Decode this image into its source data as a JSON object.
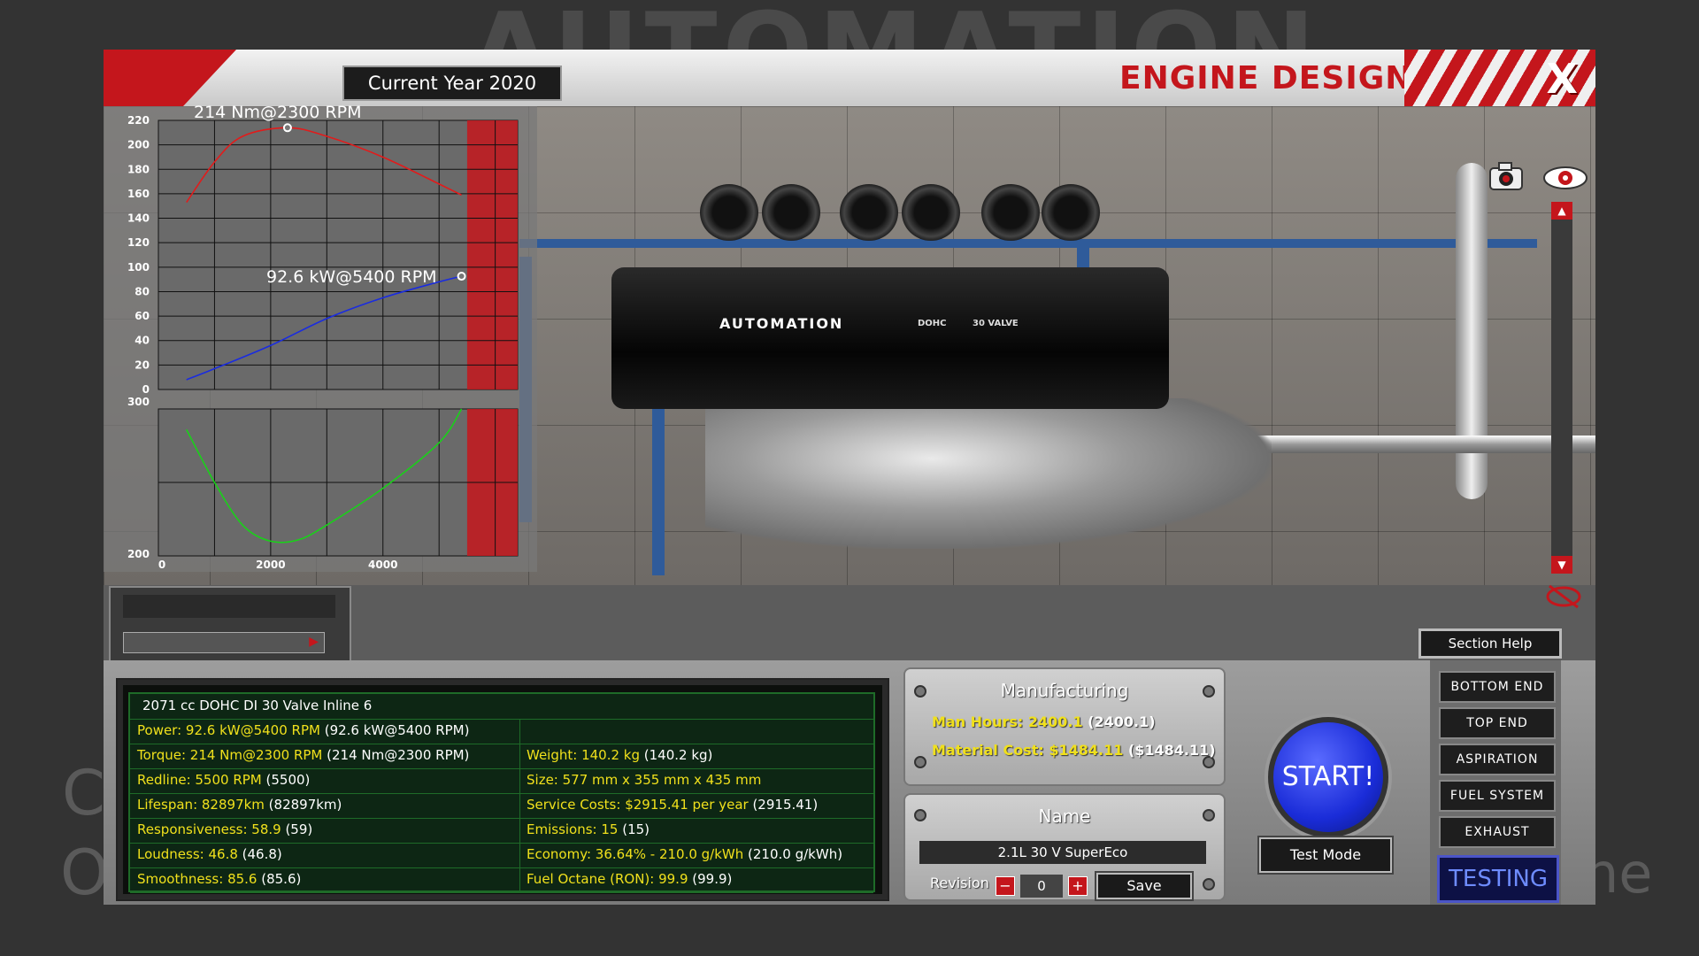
{
  "background": {
    "title_text": "AUTOMATION",
    "left_fragment_1": "C",
    "left_fragment_2": "O",
    "right_fragment": "he"
  },
  "header": {
    "current_year": "Current Year 2020",
    "section_title": "ENGINE DESIGN",
    "close_label": "X"
  },
  "engine_model": {
    "cover_logo": "AUTOMATION",
    "cover_dohc": "DOHC",
    "cover_valve": "30 VALVE"
  },
  "graph": {
    "torque_peak_label": "214 Nm@2300 RPM",
    "power_peak_label": "92.6 kW@5400 RPM",
    "top_y_ticks": [
      "220",
      "200",
      "180",
      "160",
      "140",
      "120",
      "100",
      "80",
      "60",
      "40",
      "20",
      "0"
    ],
    "bottom_y_ticks": [
      "300",
      "200"
    ],
    "x_ticks": [
      "0",
      "2000",
      "4000"
    ],
    "colors": {
      "torque": "#e21b1b",
      "power": "#1a2ce0",
      "consumption": "#19d119",
      "redline": "#c4161c"
    }
  },
  "chart_data": [
    {
      "type": "line",
      "title": "",
      "xlabel": "",
      "ylabel": "",
      "xlim": [
        0,
        6400
      ],
      "ylim": [
        0,
        220
      ],
      "series": [
        {
          "values": [
            [
              500,
              153
            ],
            [
              1000,
              186
            ],
            [
              1500,
              207
            ],
            [
              2300,
              214
            ],
            [
              3000,
              207
            ],
            [
              4000,
              190
            ],
            [
              5000,
              168
            ],
            [
              5400,
              159
            ]
          ]
        },
        {
          "values": [
            [
              500,
              8
            ],
            [
              1000,
              17
            ],
            [
              2000,
              36
            ],
            [
              3000,
              58
            ],
            [
              4000,
              75
            ],
            [
              5000,
              88
            ],
            [
              5400,
              92.6
            ]
          ]
        }
      ],
      "annotations": [
        "214 Nm@2300 RPM",
        "92.6 kW@5400 RPM"
      ]
    },
    {
      "type": "line",
      "title": "",
      "xlabel": "",
      "ylabel": "",
      "xlim": [
        0,
        6400
      ],
      "ylim": [
        200,
        300
      ],
      "series": [
        {
          "values": [
            [
              500,
              286
            ],
            [
              1000,
              250
            ],
            [
              1500,
              221
            ],
            [
              2000,
              210
            ],
            [
              2500,
              211
            ],
            [
              3000,
              221
            ],
            [
              4000,
              246
            ],
            [
              5000,
              277
            ],
            [
              5400,
              300
            ]
          ]
        }
      ]
    }
  ],
  "stats": {
    "title": "2071 cc DOHC DI 30 Valve Inline 6",
    "rows": [
      {
        "left_label": "Power: 92.6 kW@5400 RPM",
        "left_value": " (92.6 kW@5400 RPM)",
        "right_label": "",
        "right_value": ""
      },
      {
        "left_label": "Torque: 214 Nm@2300 RPM",
        "left_value": " (214 Nm@2300 RPM)",
        "right_label": "Weight: 140.2 kg",
        "right_value": " (140.2 kg)"
      },
      {
        "left_label": "Redline: 5500 RPM",
        "left_value": " (5500)",
        "right_label": "Size: 577 mm x 355 mm x 435 mm",
        "right_value": ""
      },
      {
        "left_label": "Lifespan: 82897km",
        "left_value": " (82897km)",
        "right_label": "Service Costs: $2915.41 per year",
        "right_value": " (2915.41)"
      },
      {
        "left_label": "Responsiveness: 58.9",
        "left_value": " (59)",
        "right_label": "Emissions: 15",
        "right_value": " (15)"
      },
      {
        "left_label": "Loudness: 46.8",
        "left_value": " (46.8)",
        "right_label": "Economy: 36.64% - 210.0 g/kWh",
        "right_value": " (210.0 g/kWh)"
      },
      {
        "left_label": "Smoothness: 85.6",
        "left_value": " (85.6)",
        "right_label": "Fuel Octane (RON): 99.9",
        "right_value": " (99.9)"
      }
    ]
  },
  "manufacturing": {
    "title": "Manufacturing",
    "man_hours_label": "Man Hours: 2400.1",
    "man_hours_value": " (2400.1)",
    "material_cost_label": "Material Cost: $1484.11",
    "material_cost_value": " ($1484.11)"
  },
  "name_panel": {
    "title": "Name",
    "engine_name": "2.1L 30 V SuperEco",
    "revision_label": "Revision",
    "revision_value": "0",
    "minus_label": "−",
    "plus_label": "+",
    "save_label": "Save"
  },
  "actions": {
    "start_label": "START!",
    "test_mode_label": "Test Mode"
  },
  "section_nav": {
    "help_label": "Section Help",
    "items": [
      "BOTTOM END",
      "TOP END",
      "ASPIRATION",
      "FUEL SYSTEM",
      "EXHAUST"
    ],
    "active_label": "TESTING"
  }
}
